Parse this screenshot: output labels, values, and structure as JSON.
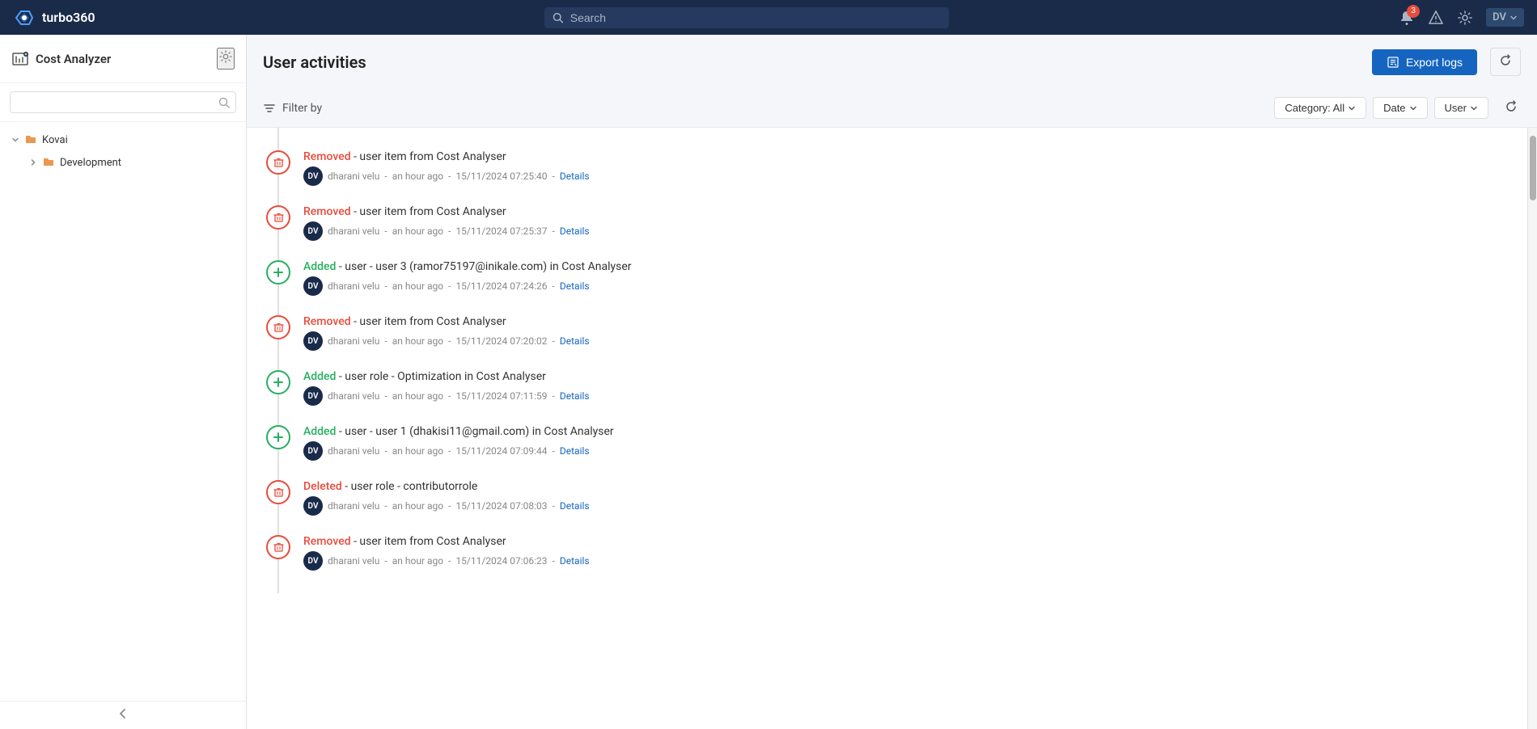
{
  "app": {
    "name": "turbo360",
    "logo_text": "turbo360"
  },
  "topnav": {
    "search_placeholder": "Search",
    "notification_badge": "3",
    "user_initials": "DV"
  },
  "sidebar": {
    "title": "Cost Analyzer",
    "search_placeholder": "",
    "gear_label": "Settings",
    "tree": [
      {
        "id": "kovai",
        "label": "Kovai",
        "expanded": true,
        "children": [
          {
            "id": "development",
            "label": "Development",
            "expanded": false
          }
        ]
      }
    ]
  },
  "main": {
    "page_title": "User activities",
    "export_btn_label": "Export logs",
    "refresh_btn_label": "Refresh",
    "filter_label": "Filter by",
    "filters": [
      {
        "id": "category",
        "label": "Category: All"
      },
      {
        "id": "date",
        "label": "Date"
      },
      {
        "id": "user",
        "label": "User"
      }
    ],
    "activities": [
      {
        "id": 1,
        "type": "removed",
        "action": "Removed",
        "description": "- user item from Cost Analyser",
        "user_initials": "DV",
        "user_name": "dharani velu",
        "time_ago": "an hour ago",
        "timestamp": "15/11/2024 07:25:40",
        "has_details": true
      },
      {
        "id": 2,
        "type": "removed",
        "action": "Removed",
        "description": "- user item from Cost Analyser",
        "user_initials": "DV",
        "user_name": "dharani velu",
        "time_ago": "an hour ago",
        "timestamp": "15/11/2024 07:25:37",
        "has_details": true
      },
      {
        "id": 3,
        "type": "added",
        "action": "Added",
        "description": "- user - user 3 (ramor75197@inikale.com) in Cost Analyser",
        "user_initials": "DV",
        "user_name": "dharani velu",
        "time_ago": "an hour ago",
        "timestamp": "15/11/2024 07:24:26",
        "has_details": true
      },
      {
        "id": 4,
        "type": "removed",
        "action": "Removed",
        "description": "- user item from Cost Analyser",
        "user_initials": "DV",
        "user_name": "dharani velu",
        "time_ago": "an hour ago",
        "timestamp": "15/11/2024 07:20:02",
        "has_details": true
      },
      {
        "id": 5,
        "type": "added",
        "action": "Added",
        "description": "- user role - Optimization in Cost Analyser",
        "user_initials": "DV",
        "user_name": "dharani velu",
        "time_ago": "an hour ago",
        "timestamp": "15/11/2024 07:11:59",
        "has_details": true
      },
      {
        "id": 6,
        "type": "added",
        "action": "Added",
        "description": "- user - user 1 (dhakisi11@gmail.com) in Cost Analyser",
        "user_initials": "DV",
        "user_name": "dharani velu",
        "time_ago": "an hour ago",
        "timestamp": "15/11/2024 07:09:44",
        "has_details": true
      },
      {
        "id": 7,
        "type": "deleted",
        "action": "Deleted",
        "description": "- user role - contributorrole",
        "user_initials": "DV",
        "user_name": "dharani velu",
        "time_ago": "an hour ago",
        "timestamp": "15/11/2024 07:08:03",
        "has_details": true
      },
      {
        "id": 8,
        "type": "removed",
        "action": "Removed",
        "description": "- user item from Cost Analyser",
        "user_initials": "DV",
        "user_name": "dharani velu",
        "time_ago": "an hour ago",
        "timestamp": "15/11/2024 07:06:23",
        "has_details": true
      }
    ],
    "details_label": "Details",
    "separator": "-"
  },
  "colors": {
    "removed": "#e74c3c",
    "added": "#27ae60",
    "deleted": "#e74c3c",
    "brand_blue": "#1a2b4a",
    "accent_blue": "#1565c0"
  }
}
